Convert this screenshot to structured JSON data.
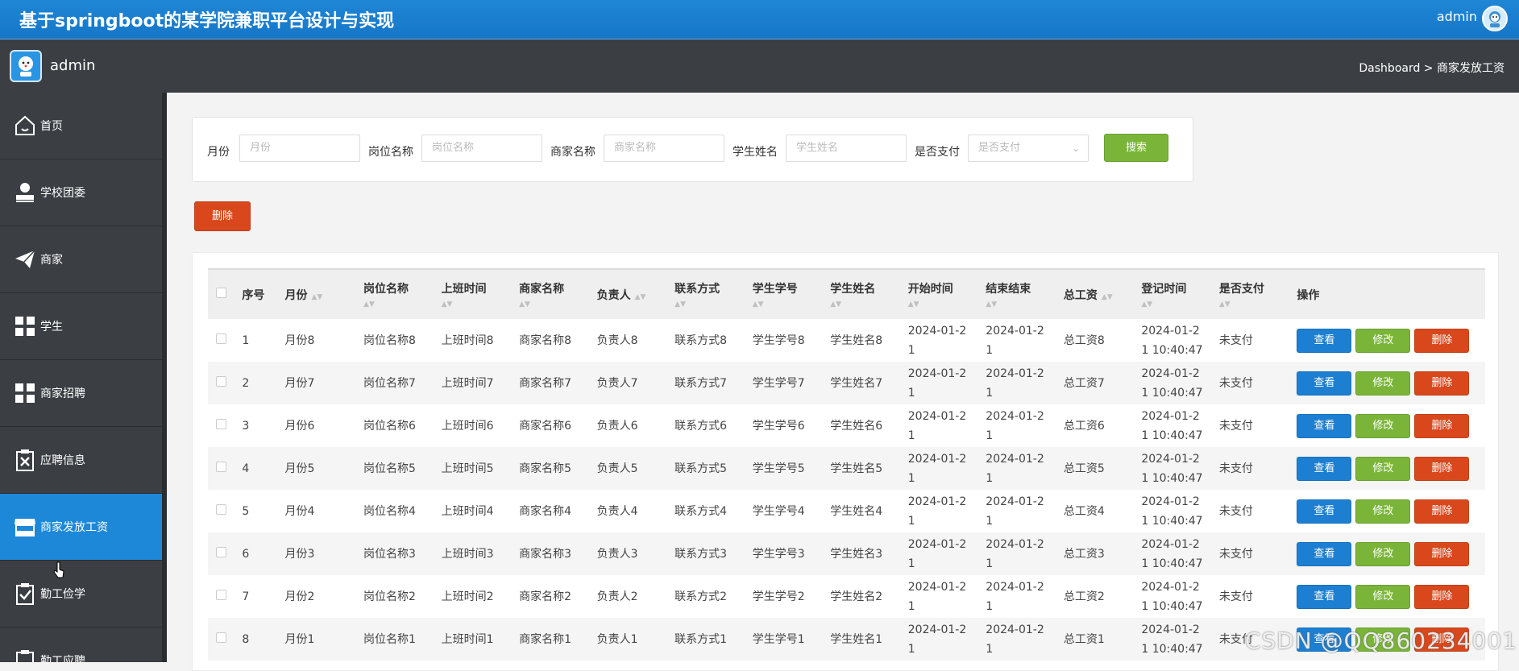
{
  "header": {
    "title": "基于springboot的某学院兼职平台设计与实现",
    "user": "admin"
  },
  "subbar": {
    "name": "admin",
    "breadcrumb": "Dashboard > 商家发放工资"
  },
  "sidebar": {
    "items": [
      {
        "label": "首页",
        "icon": "home-icon"
      },
      {
        "label": "学校团委",
        "icon": "user-icon"
      },
      {
        "label": "商家",
        "icon": "send-icon"
      },
      {
        "label": "学生",
        "icon": "grid-icon"
      },
      {
        "label": "商家招聘",
        "icon": "grid-icon"
      },
      {
        "label": "应聘信息",
        "icon": "clipboard-x-icon"
      },
      {
        "label": "商家发放工资",
        "icon": "store-icon",
        "active": true
      },
      {
        "label": "勤工俭学",
        "icon": "clipboard-check-icon"
      },
      {
        "label": "勤工应聘",
        "icon": "doc-icon"
      }
    ]
  },
  "search": {
    "fields": [
      {
        "label": "月份",
        "placeholder": "月份"
      },
      {
        "label": "岗位名称",
        "placeholder": "岗位名称"
      },
      {
        "label": "商家名称",
        "placeholder": "商家名称"
      },
      {
        "label": "学生姓名",
        "placeholder": "学生姓名"
      },
      {
        "label": "是否支付",
        "placeholder": "是否支付"
      }
    ],
    "button": "搜索"
  },
  "actions": {
    "delete": "删除"
  },
  "table": {
    "columns": [
      "序号",
      "月份",
      "岗位名称",
      "上班时间",
      "商家名称",
      "负责人",
      "联系方式",
      "学生学号",
      "学生姓名",
      "开始时间",
      "结束结束",
      "总工资",
      "登记时间",
      "是否支付",
      "操作"
    ],
    "rows": [
      {
        "no": "1",
        "month": "月份8",
        "job": "岗位名称8",
        "worktime": "上班时间8",
        "merchant": "商家名称8",
        "owner": "负责人8",
        "contact": "联系方式8",
        "sid": "学生学号8",
        "sname": "学生姓名8",
        "start_a": "2024-01-2",
        "start_b": "1",
        "end_a": "2024-01-2",
        "end_b": "1",
        "wage": "总工资8",
        "reg_a": "2024-01-2",
        "reg_b": "1 10:40:47",
        "paid": "未支付"
      },
      {
        "no": "2",
        "month": "月份7",
        "job": "岗位名称7",
        "worktime": "上班时间7",
        "merchant": "商家名称7",
        "owner": "负责人7",
        "contact": "联系方式7",
        "sid": "学生学号7",
        "sname": "学生姓名7",
        "start_a": "2024-01-2",
        "start_b": "1",
        "end_a": "2024-01-2",
        "end_b": "1",
        "wage": "总工资7",
        "reg_a": "2024-01-2",
        "reg_b": "1 10:40:47",
        "paid": "未支付"
      },
      {
        "no": "3",
        "month": "月份6",
        "job": "岗位名称6",
        "worktime": "上班时间6",
        "merchant": "商家名称6",
        "owner": "负责人6",
        "contact": "联系方式6",
        "sid": "学生学号6",
        "sname": "学生姓名6",
        "start_a": "2024-01-2",
        "start_b": "1",
        "end_a": "2024-01-2",
        "end_b": "1",
        "wage": "总工资6",
        "reg_a": "2024-01-2",
        "reg_b": "1 10:40:47",
        "paid": "未支付"
      },
      {
        "no": "4",
        "month": "月份5",
        "job": "岗位名称5",
        "worktime": "上班时间5",
        "merchant": "商家名称5",
        "owner": "负责人5",
        "contact": "联系方式5",
        "sid": "学生学号5",
        "sname": "学生姓名5",
        "start_a": "2024-01-2",
        "start_b": "1",
        "end_a": "2024-01-2",
        "end_b": "1",
        "wage": "总工资5",
        "reg_a": "2024-01-2",
        "reg_b": "1 10:40:47",
        "paid": "未支付"
      },
      {
        "no": "5",
        "month": "月份4",
        "job": "岗位名称4",
        "worktime": "上班时间4",
        "merchant": "商家名称4",
        "owner": "负责人4",
        "contact": "联系方式4",
        "sid": "学生学号4",
        "sname": "学生姓名4",
        "start_a": "2024-01-2",
        "start_b": "1",
        "end_a": "2024-01-2",
        "end_b": "1",
        "wage": "总工资4",
        "reg_a": "2024-01-2",
        "reg_b": "1 10:40:47",
        "paid": "未支付"
      },
      {
        "no": "6",
        "month": "月份3",
        "job": "岗位名称3",
        "worktime": "上班时间3",
        "merchant": "商家名称3",
        "owner": "负责人3",
        "contact": "联系方式3",
        "sid": "学生学号3",
        "sname": "学生姓名3",
        "start_a": "2024-01-2",
        "start_b": "1",
        "end_a": "2024-01-2",
        "end_b": "1",
        "wage": "总工资3",
        "reg_a": "2024-01-2",
        "reg_b": "1 10:40:47",
        "paid": "未支付"
      },
      {
        "no": "7",
        "month": "月份2",
        "job": "岗位名称2",
        "worktime": "上班时间2",
        "merchant": "商家名称2",
        "owner": "负责人2",
        "contact": "联系方式2",
        "sid": "学生学号2",
        "sname": "学生姓名2",
        "start_a": "2024-01-2",
        "start_b": "1",
        "end_a": "2024-01-2",
        "end_b": "1",
        "wage": "总工资2",
        "reg_a": "2024-01-2",
        "reg_b": "1 10:40:47",
        "paid": "未支付"
      },
      {
        "no": "8",
        "month": "月份1",
        "job": "岗位名称1",
        "worktime": "上班时间1",
        "merchant": "商家名称1",
        "owner": "负责人1",
        "contact": "联系方式1",
        "sid": "学生学号1",
        "sname": "学生姓名1",
        "start_a": "2024-01-2",
        "start_b": "1",
        "end_a": "2024-01-2",
        "end_b": "1",
        "wage": "总工资1",
        "reg_a": "2024-01-2",
        "reg_b": "1 10:40:47",
        "paid": "未支付"
      }
    ],
    "ops": {
      "view": "查看",
      "edit": "修改",
      "delete": "删除"
    }
  },
  "watermark": "CSDN @QQ860234001",
  "colors": {
    "primary": "#1e88d8",
    "success": "#7ab53a",
    "danger": "#d9481c",
    "sidebar": "#3b3f43"
  }
}
